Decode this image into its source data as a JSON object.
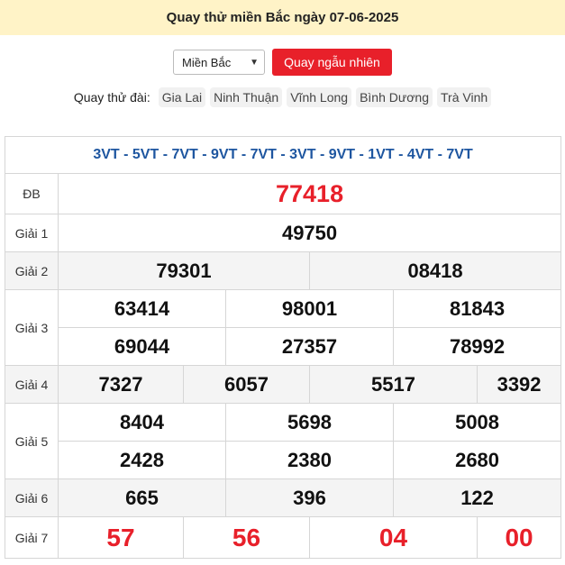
{
  "header": {
    "title": "Quay thử miền Bắc ngày 07-06-2025"
  },
  "controls": {
    "region_selected": "Miền Bắc",
    "spin_label": "Quay ngẫu nhiên"
  },
  "stations": {
    "label": "Quay thử đài:",
    "items": [
      "Gia Lai",
      "Ninh Thuận",
      "Vĩnh Long",
      "Bình Dương",
      "Trà Vinh"
    ]
  },
  "results": {
    "codes": "3VT - 5VT - 7VT - 9VT - 7VT - 3VT - 9VT - 1VT - 4VT - 7VT",
    "db": {
      "label": "ĐB",
      "value": "77418"
    },
    "g1": {
      "label": "Giải 1",
      "values": [
        "49750"
      ]
    },
    "g2": {
      "label": "Giải 2",
      "values": [
        "79301",
        "08418"
      ]
    },
    "g3": {
      "label": "Giải 3",
      "values": [
        "63414",
        "98001",
        "81843",
        "69044",
        "27357",
        "78992"
      ]
    },
    "g4": {
      "label": "Giải 4",
      "values": [
        "7327",
        "6057",
        "5517",
        "3392"
      ]
    },
    "g5": {
      "label": "Giải 5",
      "values": [
        "8404",
        "5698",
        "5008",
        "2428",
        "2380",
        "2680"
      ]
    },
    "g6": {
      "label": "Giải 6",
      "values": [
        "665",
        "396",
        "122"
      ]
    },
    "g7": {
      "label": "Giải 7",
      "values": [
        "57",
        "56",
        "04",
        "00"
      ]
    }
  },
  "colors": {
    "accent_red": "#e8202a",
    "code_blue": "#1e56a0",
    "header_bg": "#fff3c7"
  }
}
